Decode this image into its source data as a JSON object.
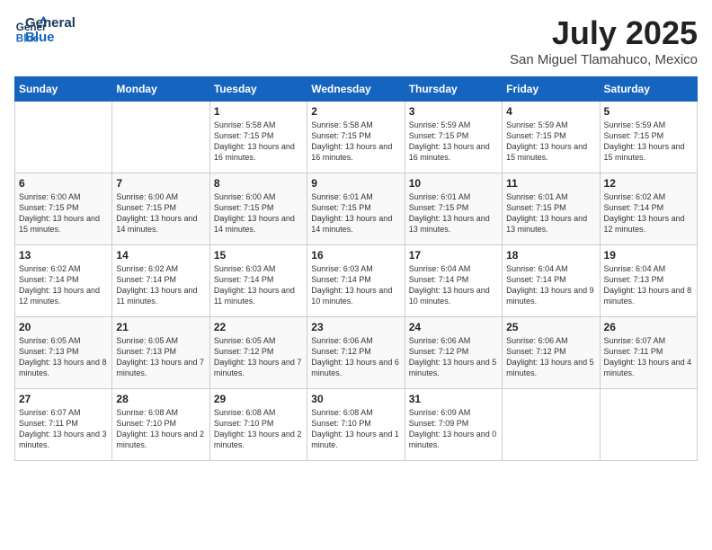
{
  "header": {
    "logo_line1": "General",
    "logo_line2": "Blue",
    "month_title": "July 2025",
    "subtitle": "San Miguel Tlamahuco, Mexico"
  },
  "weekdays": [
    "Sunday",
    "Monday",
    "Tuesday",
    "Wednesday",
    "Thursday",
    "Friday",
    "Saturday"
  ],
  "weeks": [
    [
      {
        "day": "",
        "info": ""
      },
      {
        "day": "",
        "info": ""
      },
      {
        "day": "1",
        "info": "Sunrise: 5:58 AM\nSunset: 7:15 PM\nDaylight: 13 hours\nand 16 minutes."
      },
      {
        "day": "2",
        "info": "Sunrise: 5:58 AM\nSunset: 7:15 PM\nDaylight: 13 hours\nand 16 minutes."
      },
      {
        "day": "3",
        "info": "Sunrise: 5:59 AM\nSunset: 7:15 PM\nDaylight: 13 hours\nand 16 minutes."
      },
      {
        "day": "4",
        "info": "Sunrise: 5:59 AM\nSunset: 7:15 PM\nDaylight: 13 hours\nand 15 minutes."
      },
      {
        "day": "5",
        "info": "Sunrise: 5:59 AM\nSunset: 7:15 PM\nDaylight: 13 hours\nand 15 minutes."
      }
    ],
    [
      {
        "day": "6",
        "info": "Sunrise: 6:00 AM\nSunset: 7:15 PM\nDaylight: 13 hours\nand 15 minutes."
      },
      {
        "day": "7",
        "info": "Sunrise: 6:00 AM\nSunset: 7:15 PM\nDaylight: 13 hours\nand 14 minutes."
      },
      {
        "day": "8",
        "info": "Sunrise: 6:00 AM\nSunset: 7:15 PM\nDaylight: 13 hours\nand 14 minutes."
      },
      {
        "day": "9",
        "info": "Sunrise: 6:01 AM\nSunset: 7:15 PM\nDaylight: 13 hours\nand 14 minutes."
      },
      {
        "day": "10",
        "info": "Sunrise: 6:01 AM\nSunset: 7:15 PM\nDaylight: 13 hours\nand 13 minutes."
      },
      {
        "day": "11",
        "info": "Sunrise: 6:01 AM\nSunset: 7:15 PM\nDaylight: 13 hours\nand 13 minutes."
      },
      {
        "day": "12",
        "info": "Sunrise: 6:02 AM\nSunset: 7:14 PM\nDaylight: 13 hours\nand 12 minutes."
      }
    ],
    [
      {
        "day": "13",
        "info": "Sunrise: 6:02 AM\nSunset: 7:14 PM\nDaylight: 13 hours\nand 12 minutes."
      },
      {
        "day": "14",
        "info": "Sunrise: 6:02 AM\nSunset: 7:14 PM\nDaylight: 13 hours\nand 11 minutes."
      },
      {
        "day": "15",
        "info": "Sunrise: 6:03 AM\nSunset: 7:14 PM\nDaylight: 13 hours\nand 11 minutes."
      },
      {
        "day": "16",
        "info": "Sunrise: 6:03 AM\nSunset: 7:14 PM\nDaylight: 13 hours\nand 10 minutes."
      },
      {
        "day": "17",
        "info": "Sunrise: 6:04 AM\nSunset: 7:14 PM\nDaylight: 13 hours\nand 10 minutes."
      },
      {
        "day": "18",
        "info": "Sunrise: 6:04 AM\nSunset: 7:14 PM\nDaylight: 13 hours\nand 9 minutes."
      },
      {
        "day": "19",
        "info": "Sunrise: 6:04 AM\nSunset: 7:13 PM\nDaylight: 13 hours\nand 8 minutes."
      }
    ],
    [
      {
        "day": "20",
        "info": "Sunrise: 6:05 AM\nSunset: 7:13 PM\nDaylight: 13 hours\nand 8 minutes."
      },
      {
        "day": "21",
        "info": "Sunrise: 6:05 AM\nSunset: 7:13 PM\nDaylight: 13 hours\nand 7 minutes."
      },
      {
        "day": "22",
        "info": "Sunrise: 6:05 AM\nSunset: 7:12 PM\nDaylight: 13 hours\nand 7 minutes."
      },
      {
        "day": "23",
        "info": "Sunrise: 6:06 AM\nSunset: 7:12 PM\nDaylight: 13 hours\nand 6 minutes."
      },
      {
        "day": "24",
        "info": "Sunrise: 6:06 AM\nSunset: 7:12 PM\nDaylight: 13 hours\nand 5 minutes."
      },
      {
        "day": "25",
        "info": "Sunrise: 6:06 AM\nSunset: 7:12 PM\nDaylight: 13 hours\nand 5 minutes."
      },
      {
        "day": "26",
        "info": "Sunrise: 6:07 AM\nSunset: 7:11 PM\nDaylight: 13 hours\nand 4 minutes."
      }
    ],
    [
      {
        "day": "27",
        "info": "Sunrise: 6:07 AM\nSunset: 7:11 PM\nDaylight: 13 hours\nand 3 minutes."
      },
      {
        "day": "28",
        "info": "Sunrise: 6:08 AM\nSunset: 7:10 PM\nDaylight: 13 hours\nand 2 minutes."
      },
      {
        "day": "29",
        "info": "Sunrise: 6:08 AM\nSunset: 7:10 PM\nDaylight: 13 hours\nand 2 minutes."
      },
      {
        "day": "30",
        "info": "Sunrise: 6:08 AM\nSunset: 7:10 PM\nDaylight: 13 hours\nand 1 minute."
      },
      {
        "day": "31",
        "info": "Sunrise: 6:09 AM\nSunset: 7:09 PM\nDaylight: 13 hours\nand 0 minutes."
      },
      {
        "day": "",
        "info": ""
      },
      {
        "day": "",
        "info": ""
      }
    ]
  ]
}
